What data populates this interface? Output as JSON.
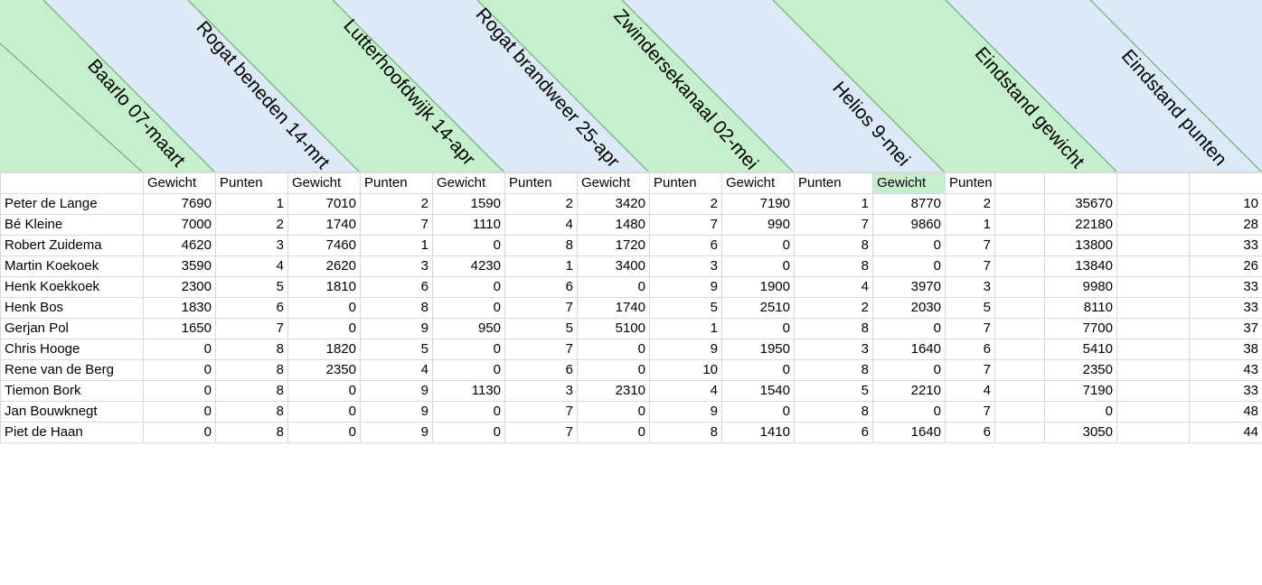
{
  "colors": {
    "blue": "#dce9f6",
    "green": "#c6efce",
    "line": "#5fa35f",
    "grid": "#d9d9d9"
  },
  "header": {
    "events": [
      {
        "label": "Baarlo 07-maart"
      },
      {
        "label": "Rogat beneden 14-mrt"
      },
      {
        "label": "Lutterhoofdwijk 14-apr"
      },
      {
        "label": "Rogat brandweer 25-apr"
      },
      {
        "label": "Zwindersekanaal  02-mei"
      },
      {
        "label": "Helios 9-mei"
      },
      {
        "label": "Eindstand gewicht"
      },
      {
        "label": "Eindstand punten"
      }
    ]
  },
  "subheader": [
    "Gewicht",
    "Punten",
    "Gewicht",
    "Punten",
    "Gewicht",
    "Punten",
    "Gewicht",
    "Punten",
    "Gewicht",
    "Punten",
    "Gewicht",
    "Punten"
  ],
  "rows": [
    {
      "name": "Peter de Lange",
      "values": [
        7690,
        1,
        7010,
        2,
        1590,
        2,
        3420,
        2,
        7190,
        1,
        8770,
        2
      ],
      "total_weight": 35670,
      "total_points": 10
    },
    {
      "name": "Bé Kleine",
      "values": [
        7000,
        2,
        1740,
        7,
        1110,
        4,
        1480,
        7,
        990,
        7,
        9860,
        1
      ],
      "total_weight": 22180,
      "total_points": 28
    },
    {
      "name": "Robert Zuidema",
      "values": [
        4620,
        3,
        7460,
        1,
        0,
        8,
        1720,
        6,
        0,
        8,
        0,
        7
      ],
      "total_weight": 13800,
      "total_points": 33
    },
    {
      "name": "Martin Koekoek",
      "values": [
        3590,
        4,
        2620,
        3,
        4230,
        1,
        3400,
        3,
        0,
        8,
        0,
        7
      ],
      "total_weight": 13840,
      "total_points": 26
    },
    {
      "name": "Henk Koekkoek",
      "values": [
        2300,
        5,
        1810,
        6,
        0,
        6,
        0,
        9,
        1900,
        4,
        3970,
        3
      ],
      "total_weight": 9980,
      "total_points": 33
    },
    {
      "name": "Henk Bos",
      "values": [
        1830,
        6,
        0,
        8,
        0,
        7,
        1740,
        5,
        2510,
        2,
        2030,
        5
      ],
      "total_weight": 8110,
      "total_points": 33
    },
    {
      "name": "Gerjan Pol",
      "values": [
        1650,
        7,
        0,
        9,
        950,
        5,
        5100,
        1,
        0,
        8,
        0,
        7
      ],
      "total_weight": 7700,
      "total_points": 37
    },
    {
      "name": "Chris Hooge",
      "values": [
        0,
        8,
        1820,
        5,
        0,
        7,
        0,
        9,
        1950,
        3,
        1640,
        6
      ],
      "total_weight": 5410,
      "total_points": 38
    },
    {
      "name": "Rene van de Berg",
      "values": [
        0,
        8,
        2350,
        4,
        0,
        6,
        0,
        10,
        0,
        8,
        0,
        7
      ],
      "total_weight": 2350,
      "total_points": 43
    },
    {
      "name": "Tiemon Bork",
      "values": [
        0,
        8,
        0,
        9,
        1130,
        3,
        2310,
        4,
        1540,
        5,
        2210,
        4
      ],
      "total_weight": 7190,
      "total_points": 33
    },
    {
      "name": "Jan Bouwknegt",
      "values": [
        0,
        8,
        0,
        9,
        0,
        7,
        0,
        9,
        0,
        8,
        0,
        7
      ],
      "total_weight": 0,
      "total_points": 48
    },
    {
      "name": "Piet de Haan",
      "values": [
        0,
        8,
        0,
        9,
        0,
        7,
        0,
        8,
        1410,
        6,
        1640,
        6
      ],
      "total_weight": 3050,
      "total_points": 44
    }
  ]
}
